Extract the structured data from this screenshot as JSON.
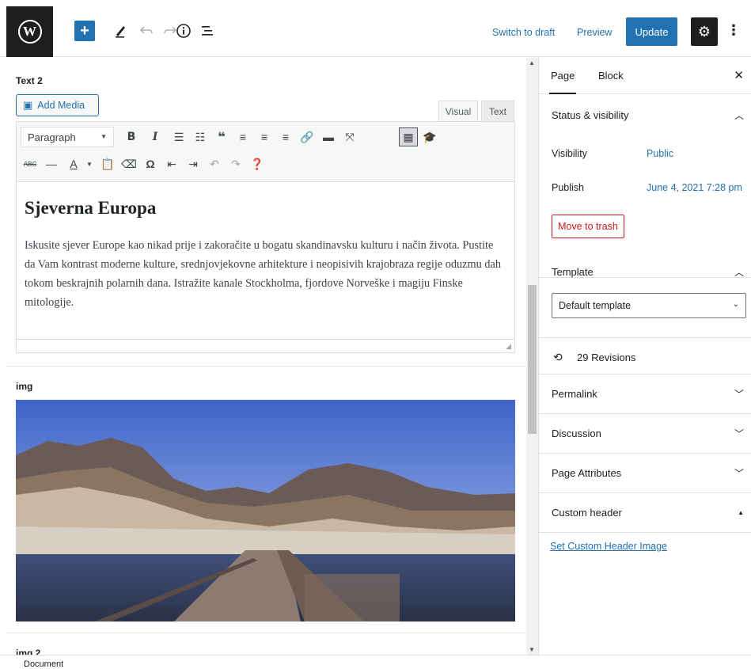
{
  "toolbar": {
    "wp_logo": "W",
    "add_icon": "+",
    "switch_to_draft": "Switch to draft",
    "preview": "Preview",
    "update": "Update"
  },
  "editor": {
    "block1_label": "Text 2",
    "add_media": "Add Media",
    "tab_visual": "Visual",
    "tab_text": "Text",
    "format": "Paragraph",
    "heading": "Sjeverna Europa",
    "paragraph": "Iskusite sjever Europe kao nikad prije i zakoračite u bogatu skandinavsku kulturu i način života. Pustite da Vam kontrast moderne kulture, srednjovjekovne arhitekture i neopisivih krajobraza regije oduzmu dah tokom beskrajnih polarnih dana. Istražite kanale Stockholma, fjordove Norveške i magiju Finske mitologije.",
    "block2_label": "img",
    "block3_label": "img 2"
  },
  "sidebar": {
    "tab_page": "Page",
    "tab_block": "Block",
    "status_title": "Status & visibility",
    "visibility_label": "Visibility",
    "visibility_value": "Public",
    "publish_label": "Publish",
    "publish_value": "June 4, 2021 7:28 pm",
    "move_to_trash": "Move to trash",
    "template_title": "Template",
    "template_value": "Default template",
    "revisions": "29 Revisions",
    "permalink": "Permalink",
    "discussion": "Discussion",
    "page_attributes": "Page Attributes",
    "custom_header": "Custom header",
    "set_header": "Set Custom Header Image"
  },
  "footer": {
    "breadcrumb": "Document"
  },
  "colors": {
    "accent": "#2271b1",
    "danger": "#cc1818",
    "dark": "#1e1e1e"
  }
}
